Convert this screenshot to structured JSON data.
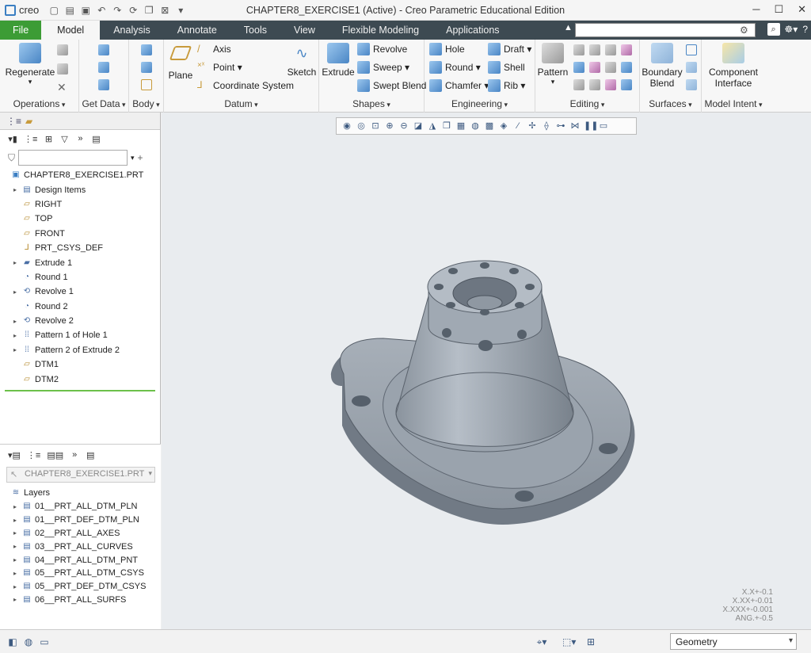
{
  "app": {
    "logo_text": "creo",
    "window_title": "CHAPTER8_EXERCISE1 (Active) - Creo Parametric Educational Edition"
  },
  "tabs": [
    "File",
    "Model",
    "Analysis",
    "Annotate",
    "Tools",
    "View",
    "Flexible Modeling",
    "Applications"
  ],
  "active_tab": "Model",
  "ribbon": {
    "operations": {
      "label": "Operations",
      "regenerate": "Regenerate"
    },
    "get_data": {
      "label": "Get Data"
    },
    "body": {
      "label": "Body"
    },
    "datum": {
      "label": "Datum",
      "plane": "Plane",
      "axis": "Axis",
      "point": "Point",
      "csys": "Coordinate System",
      "sketch": "Sketch"
    },
    "shapes": {
      "label": "Shapes",
      "extrude": "Extrude",
      "revolve": "Revolve",
      "sweep": "Sweep",
      "swept_blend": "Swept Blend"
    },
    "engineering": {
      "label": "Engineering",
      "hole": "Hole",
      "round": "Round",
      "chamfer": "Chamfer",
      "draft": "Draft",
      "shell": "Shell",
      "rib": "Rib"
    },
    "editing": {
      "label": "Editing",
      "pattern": "Pattern"
    },
    "surfaces": {
      "label": "Surfaces",
      "boundary_blend_1": "Boundary",
      "boundary_blend_2": "Blend"
    },
    "model_intent": {
      "label": "Model Intent",
      "component_interface_1": "Component",
      "component_interface_2": "Interface"
    }
  },
  "model_tree": {
    "root": "CHAPTER8_EXERCISE1.PRT",
    "items": [
      {
        "label": "Design Items",
        "icon": "design-items-icon",
        "expandable": true
      },
      {
        "label": "RIGHT",
        "icon": "datum-plane-icon",
        "expandable": false
      },
      {
        "label": "TOP",
        "icon": "datum-plane-icon",
        "expandable": false
      },
      {
        "label": "FRONT",
        "icon": "datum-plane-icon",
        "expandable": false
      },
      {
        "label": "PRT_CSYS_DEF",
        "icon": "csys-icon",
        "expandable": false
      },
      {
        "label": "Extrude 1",
        "icon": "extrude-icon",
        "expandable": true
      },
      {
        "label": "Round 1",
        "icon": "round-icon",
        "expandable": false
      },
      {
        "label": "Revolve 1",
        "icon": "revolve-icon",
        "expandable": true
      },
      {
        "label": "Round 2",
        "icon": "round-icon",
        "expandable": false
      },
      {
        "label": "Revolve 2",
        "icon": "revolve-icon",
        "expandable": true
      },
      {
        "label": "Pattern 1 of Hole 1",
        "icon": "pattern-icon",
        "expandable": true
      },
      {
        "label": "Pattern 2 of Extrude 2",
        "icon": "pattern-icon",
        "expandable": true
      },
      {
        "label": "DTM1",
        "icon": "datum-plane-icon",
        "expandable": false
      },
      {
        "label": "DTM2",
        "icon": "datum-plane-icon",
        "expandable": false
      }
    ]
  },
  "layer_tree": {
    "model_select": "CHAPTER8_EXERCISE1.PRT",
    "heading": "Layers",
    "items": [
      "01__PRT_ALL_DTM_PLN",
      "01__PRT_DEF_DTM_PLN",
      "02__PRT_ALL_AXES",
      "03__PRT_ALL_CURVES",
      "04__PRT_ALL_DTM_PNT",
      "05__PRT_ALL_DTM_CSYS",
      "05__PRT_DEF_DTM_CSYS",
      "06__PRT_ALL_SURFS"
    ]
  },
  "viewport": {
    "tolerances": [
      "X.X+-0.1",
      "X.XX+-0.01",
      "X.XXX+-0.001",
      "ANG.+-0.5"
    ]
  },
  "statusbar": {
    "filter_value": "Geometry"
  },
  "colors": {
    "file_tab": "#3c9c35",
    "tabbar": "#3d4a52",
    "part": "#9aa3ad"
  }
}
